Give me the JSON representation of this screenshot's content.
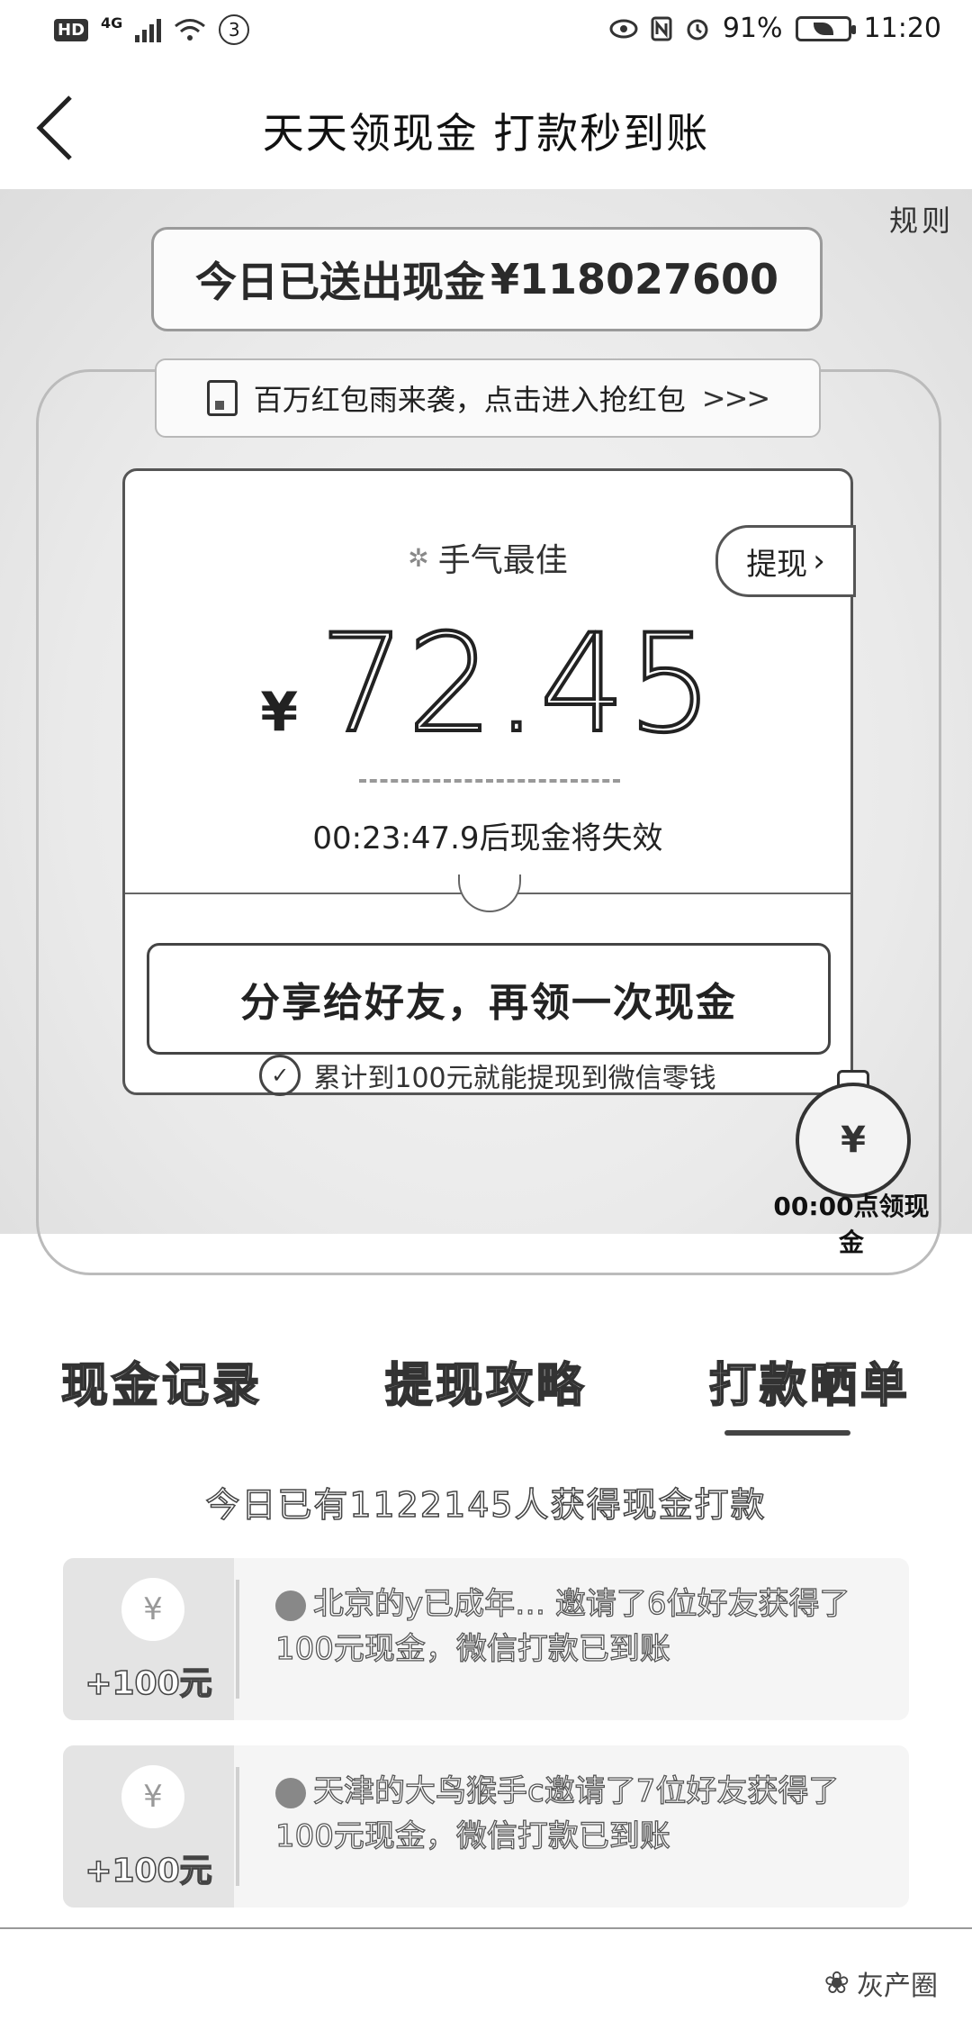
{
  "status_bar": {
    "hd": "HD",
    "network": "4G",
    "notification_count": "3",
    "battery": "91%",
    "time": "11:20",
    "icons": [
      "eye-icon",
      "nfc-icon",
      "alarm-icon"
    ]
  },
  "nav": {
    "title": "天天领现金 打款秒到账"
  },
  "hero": {
    "corner_tag": "规则",
    "total_prefix": "今日已送出现金",
    "total_amount": "¥118027600",
    "rain_text": "百万红包雨来袭，点击进入抢红包",
    "rain_arrows": ">>>",
    "luck_label": "手气最佳",
    "withdraw_label": "提现",
    "currency": "¥",
    "amount": "72.45",
    "countdown": "00:23:47.9后现金将失效",
    "share_label": "分享给好友，再领一次现金",
    "tip": "累计到100元就能提现到微信零钱",
    "clock_symbol": "¥",
    "clock_label": "00:00点领现金"
  },
  "tabs": [
    {
      "label": "现金记录"
    },
    {
      "label": "提现攻略"
    },
    {
      "label": "打款晒单"
    }
  ],
  "active_tab": 2,
  "stat_line": "今日已有1122145人获得现金打款",
  "records": [
    {
      "coin": "¥",
      "amount": "+100元",
      "text": "北京的y已成年… 邀请了6位好友获得了100元现金，微信打款已到账"
    },
    {
      "coin": "¥",
      "amount": "+100元",
      "text": "天津的大鸟猴手c邀请了7位好友获得了100元现金，微信打款已到账"
    }
  ],
  "watermark": "灰产圈"
}
